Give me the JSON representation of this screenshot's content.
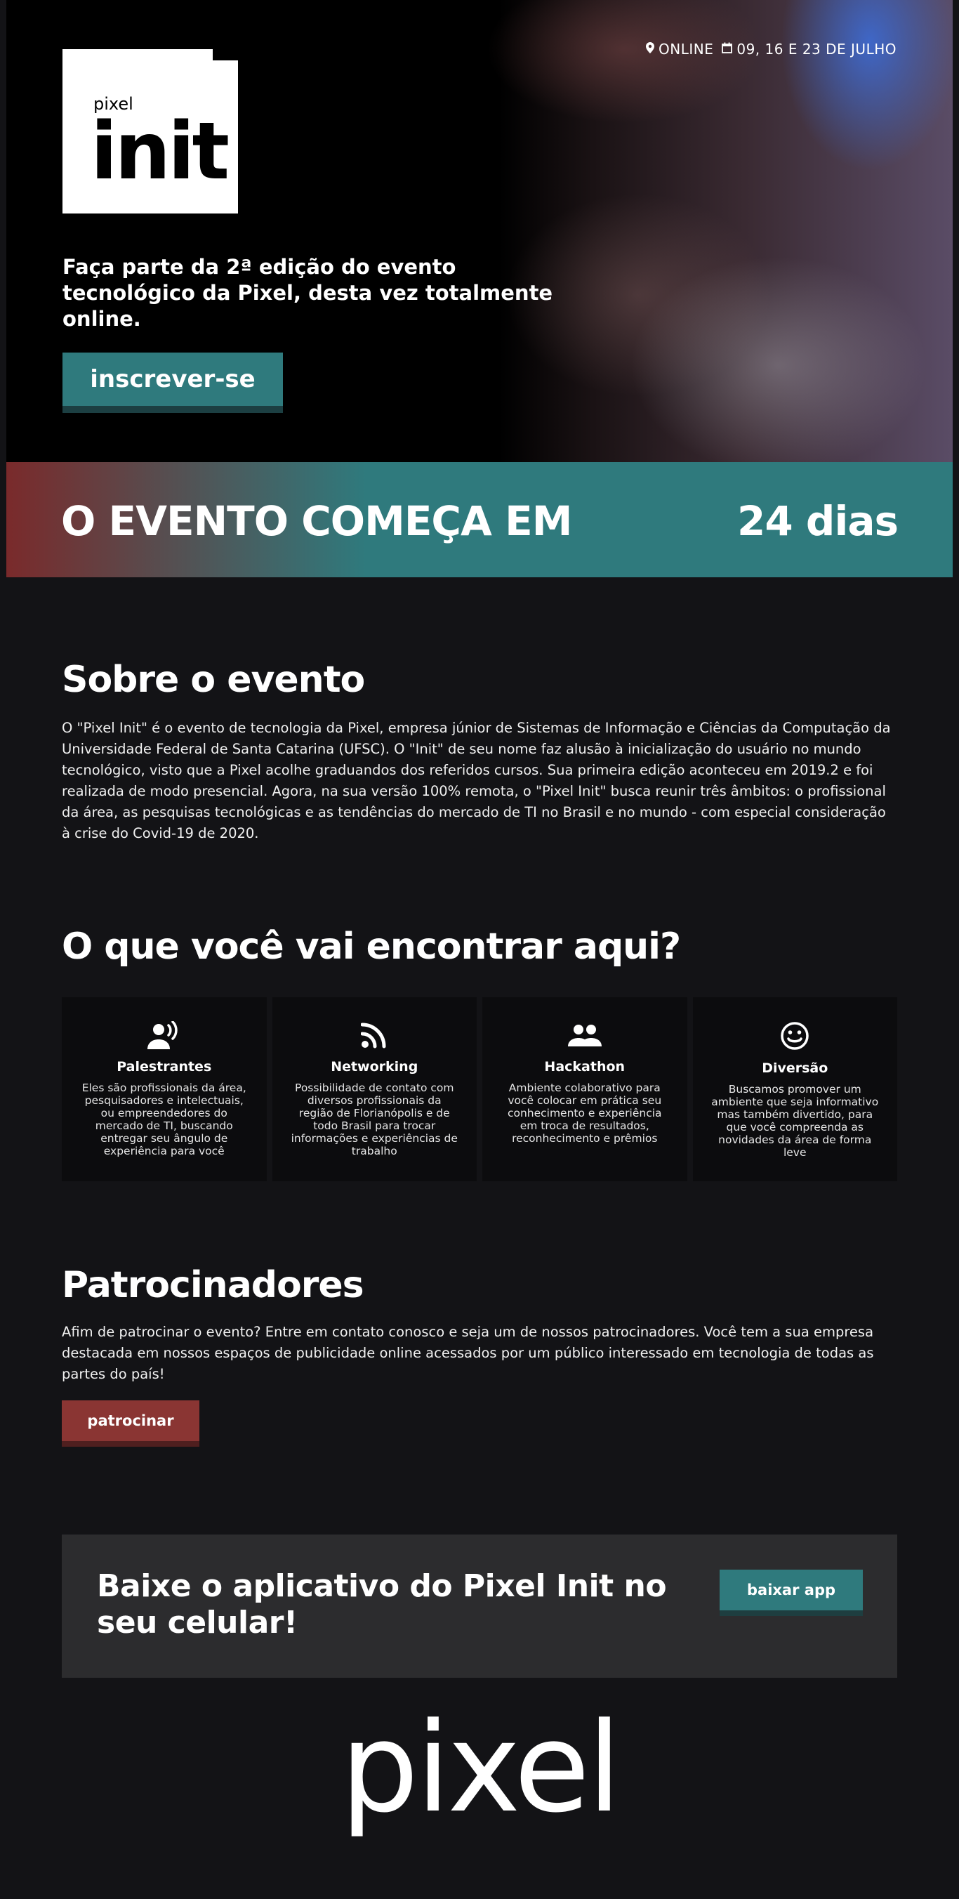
{
  "hero": {
    "location_icon": "map-pin-icon",
    "location": "ONLINE",
    "date_icon": "calendar-icon",
    "dates": "09, 16 E 23 DE JULHO",
    "logo_small": "pixel",
    "logo_big": "init",
    "tagline": "Faça parte da 2ª edição do evento tecnológico da Pixel, desta vez totalmente online.",
    "cta_label": "inscrever-se"
  },
  "countdown": {
    "label": "O EVENTO COMEÇA EM",
    "value": "24 dias"
  },
  "about": {
    "title": "Sobre o evento",
    "text": "O \"Pixel Init\" é o evento de tecnologia da Pixel, empresa júnior de Sistemas de Informação e Ciências da Computação da Universidade Federal de Santa Catarina (UFSC). O \"Init\" de seu nome faz alusão à inicialização do usuário no mundo tecnológico, visto que a Pixel acolhe graduandos dos referidos cursos. Sua primeira edição aconteceu em 2019.2 e foi realizada de modo presencial. Agora, na sua versão 100% remota, o \"Pixel Init\" busca reunir três âmbitos: o profissional da área, as pesquisas tecnológicas e as tendências do mercado de TI no Brasil e no mundo - com especial consideração à crise do Covid-19 de 2020."
  },
  "features": {
    "title": "O que você vai encontrar aqui?",
    "cards": [
      {
        "icon": "speaker-person-icon",
        "title": "Palestrantes",
        "desc": "Eles são profissionais da área, pesquisadores e intelectuais, ou empreendedores do mercado de TI, buscando entregar seu ângulo de experiência para você"
      },
      {
        "icon": "rss-icon",
        "title": "Networking",
        "desc": "Possibilidade de contato com diversos profissionais da região de Florianópolis e de todo Brasil para trocar informações e experiências de trabalho"
      },
      {
        "icon": "people-icon",
        "title": "Hackathon",
        "desc": "Ambiente colaborativo para você colocar em prática seu conhecimento e experiência em troca de resultados, reconhecimento e prêmios"
      },
      {
        "icon": "smile-icon",
        "title": "Diversão",
        "desc": "Buscamos promover um ambiente que seja informativo mas também divertido, para que você compreenda as novidades da área de forma leve"
      }
    ]
  },
  "sponsors": {
    "title": "Patrocinadores",
    "text": "Afim de patrocinar o evento? Entre em contato conosco e seja um de nossos patrocinadores. Você tem a sua empresa destacada em nossos espaços de publicidade online acessados por um público interessado em tecnologia de todas as partes do país!",
    "cta_label": "patrocinar"
  },
  "app": {
    "title": "Baixe o aplicativo do Pixel Init no seu celular!",
    "cta_label": "baixar app"
  },
  "footer": {
    "logo": "pixel"
  },
  "colors": {
    "teal": "#2f7a7d",
    "red": "#8a3533",
    "background": "#131316",
    "card": "#0c0c0e",
    "app_box": "#2c2c2e"
  }
}
